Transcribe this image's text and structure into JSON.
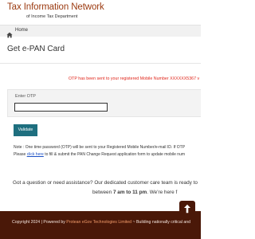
{
  "header": {
    "title": "Tax Information Network",
    "subtitle": "of Income Tax Department"
  },
  "breadcrumb": {
    "home_label": "Home"
  },
  "page": {
    "title": "Get e-PAN Card"
  },
  "otp_message": "OTP has been sent to your registered Mobile Number XXXXXX5367 v",
  "otp_form": {
    "label": "Enter OTP",
    "value": "",
    "placeholder": ""
  },
  "validate_button": "Validate",
  "note": {
    "line1": "Note : One time password (OTP) will be sent to your Registered Mobile Number/e-mail ID. If OTP",
    "line2_prefix": "Please ",
    "line2_link": "click here",
    "line2_suffix": " to fill & submit the PAN Change Request application form to update mobile num"
  },
  "help": {
    "line1": "Got a question or need assistance? Our dedicated customer care team is ready to",
    "line2_prefix": "between ",
    "line2_hours": "7 am to 11 pm",
    "line2_suffix": ". We're here f"
  },
  "footer": {
    "prefix": "Copyright 2024 | Powered by ",
    "company": "Protean eGov Technologies Limited",
    "suffix": " ~ Building nationally critical and"
  },
  "icons": {
    "home": "home-icon",
    "scroll_top": "arrow-up-icon"
  },
  "colors": {
    "brand": "#9b3a10",
    "footer_bg": "#4a1808",
    "button_bg": "#1e6f7f",
    "alert": "#e0261b",
    "link": "#1a4fc4"
  }
}
